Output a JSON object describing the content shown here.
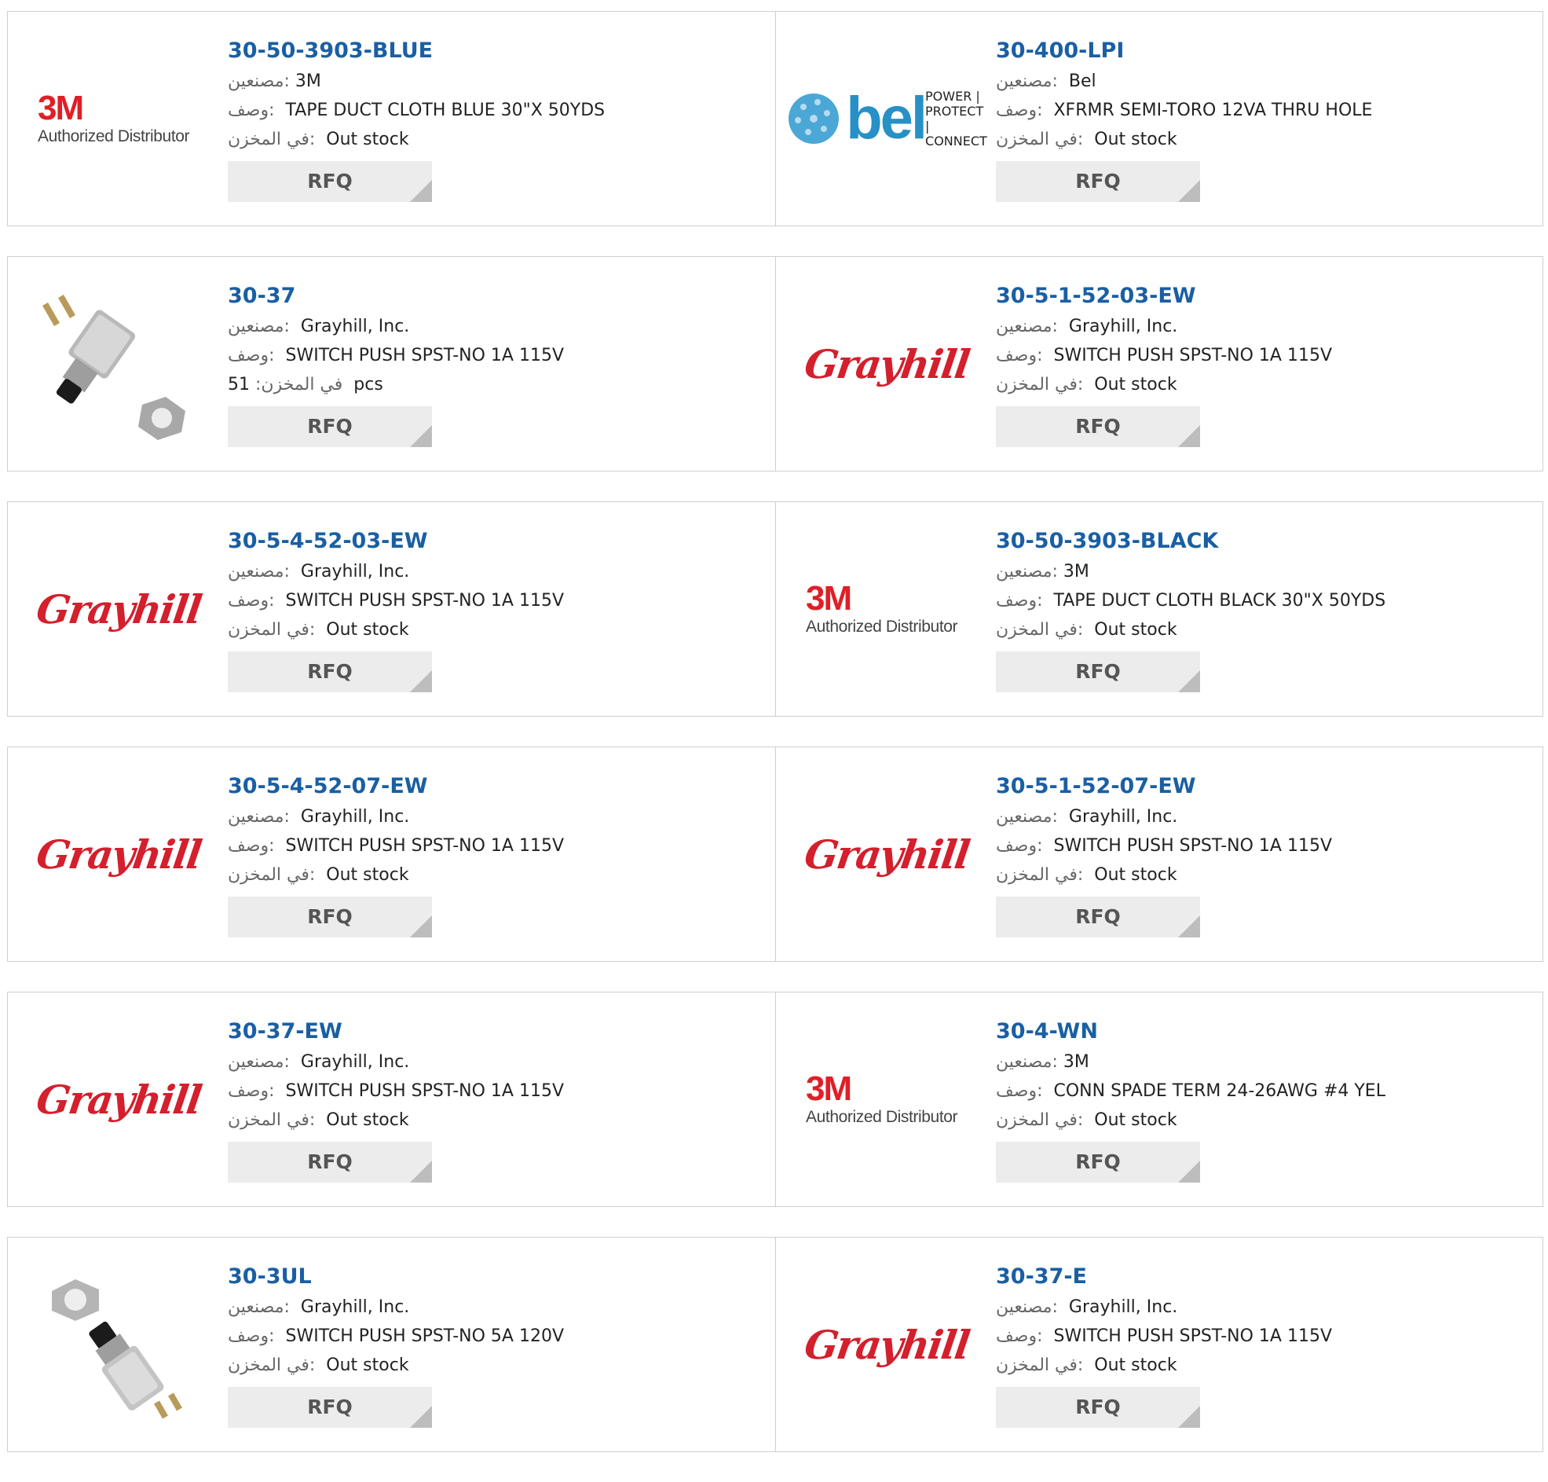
{
  "labels": {
    "manufacturer": "مصنعين",
    "description": "وصف",
    "stock": "في المخزن",
    "rfq": "RFQ"
  },
  "brand_colors": {
    "part_link": "#1a5fa3",
    "grayhill": "#d41f2c",
    "three_m": "#e01f26",
    "bel": "#2790c6"
  },
  "products": [
    {
      "part": "30-50-3903-BLUE",
      "manufacturer": "3M",
      "description": "TAPE DUCT CLOTH BLUE 30\"X 50YDS",
      "stock": "Out stock",
      "logo": "3m-logo",
      "logo_text": "3M",
      "logo_sub": "Authorized Distributor"
    },
    {
      "part": "30-400-LPI",
      "manufacturer": "Bel",
      "description": "XFRMR SEMI-TORO 12VA THRU HOLE",
      "stock": "Out stock",
      "logo": "bel-logo",
      "logo_text": "bel",
      "logo_sub": "POWER | PROTECT | CONNECT"
    },
    {
      "part": "30-37",
      "manufacturer": "Grayhill, Inc.",
      "description": "SWITCH PUSH SPST-NO 1A 115V",
      "stock": "51",
      "stock_unit": "pcs",
      "logo": "push-switch-photo"
    },
    {
      "part": "30-5-1-52-03-EW",
      "manufacturer": "Grayhill, Inc.",
      "description": "SWITCH PUSH SPST-NO 1A 115V",
      "stock": "Out stock",
      "logo": "grayhill-logo",
      "logo_text": "Grayhill"
    },
    {
      "part": "30-5-4-52-03-EW",
      "manufacturer": "Grayhill, Inc.",
      "description": "SWITCH PUSH SPST-NO 1A 115V",
      "stock": "Out stock",
      "logo": "grayhill-logo",
      "logo_text": "Grayhill"
    },
    {
      "part": "30-50-3903-BLACK",
      "manufacturer": "3M",
      "description": "TAPE DUCT CLOTH BLACK 30\"X 50YDS",
      "stock": "Out stock",
      "logo": "3m-logo",
      "logo_text": "3M",
      "logo_sub": "Authorized Distributor"
    },
    {
      "part": "30-5-4-52-07-EW",
      "manufacturer": "Grayhill, Inc.",
      "description": "SWITCH PUSH SPST-NO 1A 115V",
      "stock": "Out stock",
      "logo": "grayhill-logo",
      "logo_text": "Grayhill"
    },
    {
      "part": "30-5-1-52-07-EW",
      "manufacturer": "Grayhill, Inc.",
      "description": "SWITCH PUSH SPST-NO 1A 115V",
      "stock": "Out stock",
      "logo": "grayhill-logo",
      "logo_text": "Grayhill"
    },
    {
      "part": "30-37-EW",
      "manufacturer": "Grayhill, Inc.",
      "description": "SWITCH PUSH SPST-NO 1A 115V",
      "stock": "Out stock",
      "logo": "grayhill-logo",
      "logo_text": "Grayhill"
    },
    {
      "part": "30-4-WN",
      "manufacturer": "3M",
      "description": "CONN SPADE TERM 24-26AWG #4 YEL",
      "stock": "Out stock",
      "logo": "3m-logo",
      "logo_text": "3M",
      "logo_sub": "Authorized Distributor"
    },
    {
      "part": "30-3UL",
      "manufacturer": "Grayhill, Inc.",
      "description": "SWITCH PUSH SPST-NO 5A 120V",
      "stock": "Out stock",
      "logo": "push-switch-photo-2"
    },
    {
      "part": "30-37-E",
      "manufacturer": "Grayhill, Inc.",
      "description": "SWITCH PUSH SPST-NO 1A 115V",
      "stock": "Out stock",
      "logo": "grayhill-logo",
      "logo_text": "Grayhill"
    }
  ]
}
